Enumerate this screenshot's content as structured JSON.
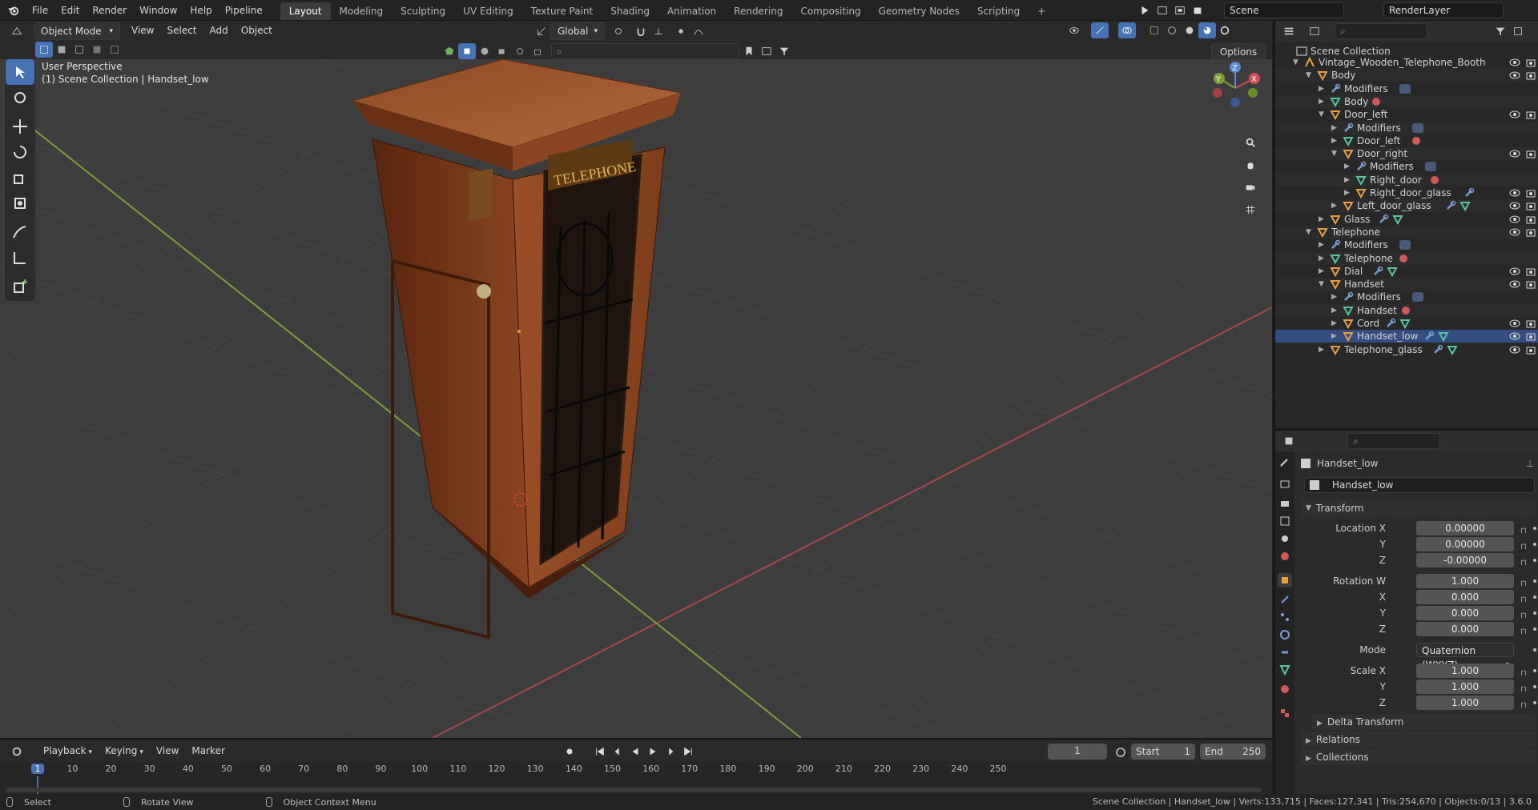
{
  "menubar": {
    "items": [
      "File",
      "Edit",
      "Render",
      "Window",
      "Help",
      "Pipeline"
    ],
    "workspaces": [
      "Layout",
      "Modeling",
      "Sculpting",
      "UV Editing",
      "Texture Paint",
      "Shading",
      "Animation",
      "Rendering",
      "Compositing",
      "Geometry Nodes",
      "Scripting"
    ],
    "active_workspace": "Layout",
    "add_workspace": "+",
    "scene": "Scene",
    "view_layer": "RenderLayer"
  },
  "viewport_header": {
    "mode": "Object Mode",
    "menus": [
      "View",
      "Select",
      "Add",
      "Object"
    ],
    "transform_orientation": "Global",
    "options": "Options"
  },
  "viewport": {
    "perspective": "User Perspective",
    "context": "(1) Scene Collection | Handset_low",
    "sign_text": "TELEPHONE",
    "gizmo": {
      "x": "X",
      "y": "Y",
      "z": "Z"
    }
  },
  "outliner": {
    "root": "Scene Collection",
    "rows": [
      {
        "label": "Vintage_Wooden_Telephone_Booth",
        "depth": 0,
        "open": true,
        "icon": "empty",
        "vis": true
      },
      {
        "label": "Body",
        "depth": 1,
        "open": true,
        "icon": "object",
        "vis": true
      },
      {
        "label": "Modifiers",
        "depth": 2,
        "open": false,
        "icon": "wrench",
        "vis": false,
        "extra": "modifier"
      },
      {
        "label": "Body",
        "depth": 2,
        "open": false,
        "icon": "mesh",
        "vis": false,
        "extra": "material"
      },
      {
        "label": "Door_left",
        "depth": 2,
        "open": true,
        "icon": "object",
        "vis": true
      },
      {
        "label": "Modifiers",
        "depth": 3,
        "open": false,
        "icon": "wrench",
        "vis": false,
        "extra": "modifier"
      },
      {
        "label": "Door_left",
        "depth": 3,
        "open": false,
        "icon": "mesh",
        "vis": false,
        "extra": "material"
      },
      {
        "label": "Door_right",
        "depth": 3,
        "open": true,
        "icon": "object",
        "vis": true
      },
      {
        "label": "Modifiers",
        "depth": 4,
        "open": false,
        "icon": "wrench",
        "vis": false,
        "extra": "modifier"
      },
      {
        "label": "Right_door",
        "depth": 4,
        "open": false,
        "icon": "mesh",
        "vis": false,
        "extra": "material"
      },
      {
        "label": "Right_door_glass",
        "depth": 4,
        "open": false,
        "icon": "object",
        "vis": true,
        "extra": "wrench"
      },
      {
        "label": "Left_door_glass",
        "depth": 3,
        "open": false,
        "icon": "object",
        "vis": true,
        "extra": "wrench-mesh"
      },
      {
        "label": "Glass",
        "depth": 2,
        "open": false,
        "icon": "object",
        "vis": true,
        "extra": "wrench-mesh"
      },
      {
        "label": "Telephone",
        "depth": 1,
        "open": true,
        "icon": "object",
        "vis": true
      },
      {
        "label": "Modifiers",
        "depth": 2,
        "open": false,
        "icon": "wrench",
        "vis": false,
        "extra": "modifier"
      },
      {
        "label": "Telephone",
        "depth": 2,
        "open": false,
        "icon": "mesh",
        "vis": false,
        "extra": "material"
      },
      {
        "label": "Dial",
        "depth": 2,
        "open": false,
        "icon": "object",
        "vis": true,
        "extra": "wrench-mesh"
      },
      {
        "label": "Handset",
        "depth": 2,
        "open": true,
        "icon": "object",
        "vis": true
      },
      {
        "label": "Modifiers",
        "depth": 3,
        "open": false,
        "icon": "wrench",
        "vis": false,
        "extra": "modifier"
      },
      {
        "label": "Handset",
        "depth": 3,
        "open": false,
        "icon": "mesh",
        "vis": false,
        "extra": "material"
      },
      {
        "label": "Cord",
        "depth": 3,
        "open": false,
        "icon": "object",
        "vis": true,
        "extra": "wrench-mesh"
      },
      {
        "label": "Handset_low",
        "depth": 3,
        "open": false,
        "icon": "object",
        "vis": true,
        "extra": "wrench-mesh",
        "selected": true
      },
      {
        "label": "Telephone_glass",
        "depth": 2,
        "open": false,
        "icon": "object",
        "vis": true,
        "extra": "wrench-mesh"
      }
    ]
  },
  "properties": {
    "object_name": "Handset_low",
    "datablock": "Handset_low",
    "transform_header": "Transform",
    "location": {
      "label": "Location X",
      "x": "0.00000",
      "y": "0.00000",
      "z": "-0.00000"
    },
    "rotation": {
      "label": "Rotation W",
      "w": "1.000",
      "x": "0.000",
      "y": "0.000",
      "z": "0.000"
    },
    "mode": {
      "label": "Mode",
      "value": "Quaternion (WXYZ)"
    },
    "scale": {
      "label": "Scale X",
      "x": "1.000",
      "y": "1.000",
      "z": "1.000"
    },
    "axis_labels": {
      "x": "X",
      "y": "Y",
      "z": "Z"
    },
    "sections": [
      "Delta Transform",
      "Relations",
      "Collections"
    ]
  },
  "timeline": {
    "menus": [
      "Playback",
      "Keying",
      "View",
      "Marker"
    ],
    "current_frame": "1",
    "start_label": "Start",
    "start": "1",
    "end_label": "End",
    "end": "250",
    "ruler": [
      "1",
      "10",
      "20",
      "30",
      "40",
      "50",
      "60",
      "70",
      "80",
      "90",
      "100",
      "110",
      "120",
      "130",
      "140",
      "150",
      "160",
      "170",
      "180",
      "190",
      "200",
      "210",
      "220",
      "230",
      "240",
      "250"
    ]
  },
  "statusbar": {
    "hints": [
      "Select",
      "Rotate View",
      "Object Context Menu"
    ],
    "stats": "Scene Collection | Handset_low | Verts:133,715 | Faces:127,341 | Tris:254,670 | Objects:0/13 | 3.6.0"
  },
  "colors": {
    "accent": "#4772b3",
    "orange": "#e8a043",
    "mesh": "#56c6a0",
    "modifier": "#7a9ed6",
    "material": "#d05a5a",
    "grid_red": "#a8484a",
    "grid_green": "#7ea03a"
  }
}
